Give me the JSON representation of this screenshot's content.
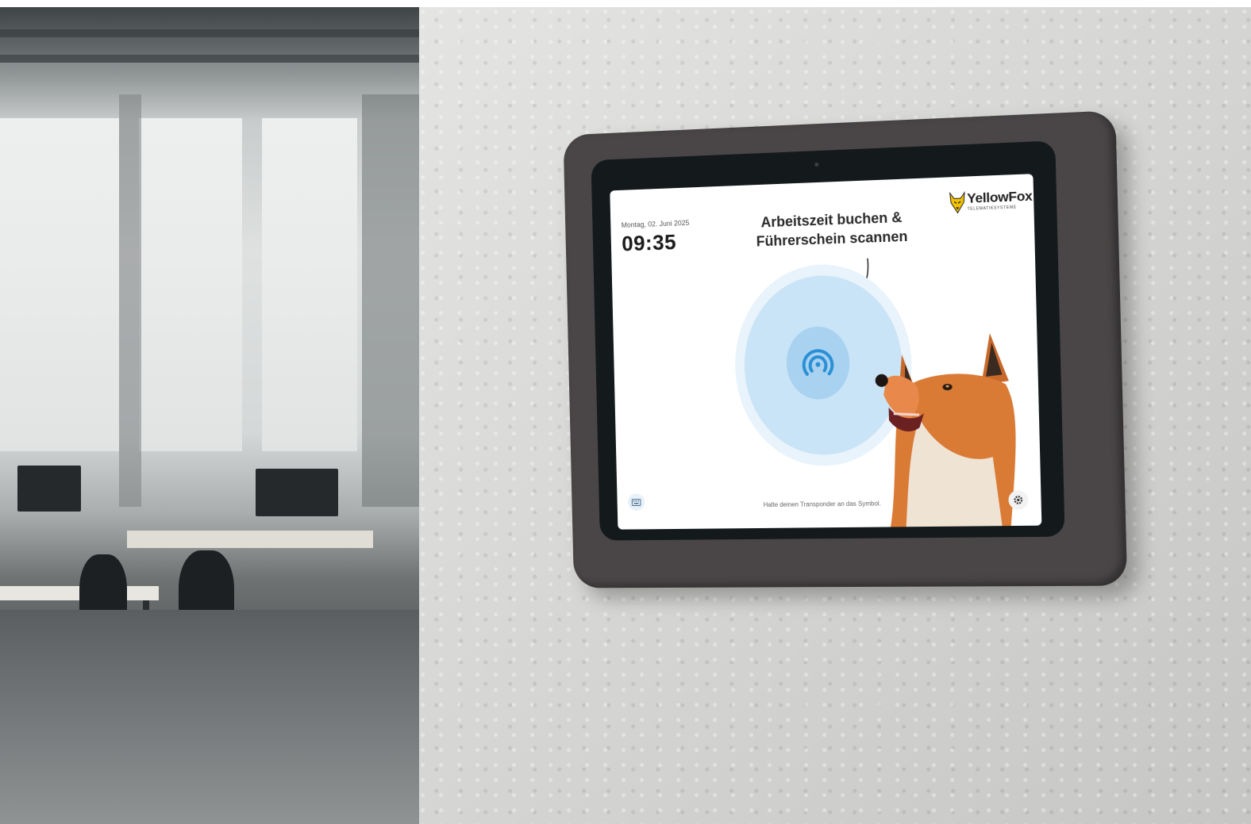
{
  "screen": {
    "date": "Montag, 02. Juni 2025",
    "time": "09:35",
    "headline_line1": "Arbeitszeit buchen &",
    "headline_line2": "Führerschein scannen",
    "hint": "Halte deinen Transponder an das Symbol.",
    "logo": {
      "name": "YellowFox",
      "tagline": "TELEMATIKSYSTEME"
    }
  },
  "icons": {
    "nfc": "nfc-icon",
    "keyboard": "keyboard-icon",
    "settings": "gear-icon",
    "logo": "fox-logo-icon"
  },
  "colors": {
    "accent": "#2a8fd4",
    "ring_outer": "#e8f3fb",
    "ring_mid": "#c9e4f6",
    "ring_inner": "#a8d2f0",
    "device_frame": "#4a4647",
    "brand_yellow": "#f2c200"
  }
}
